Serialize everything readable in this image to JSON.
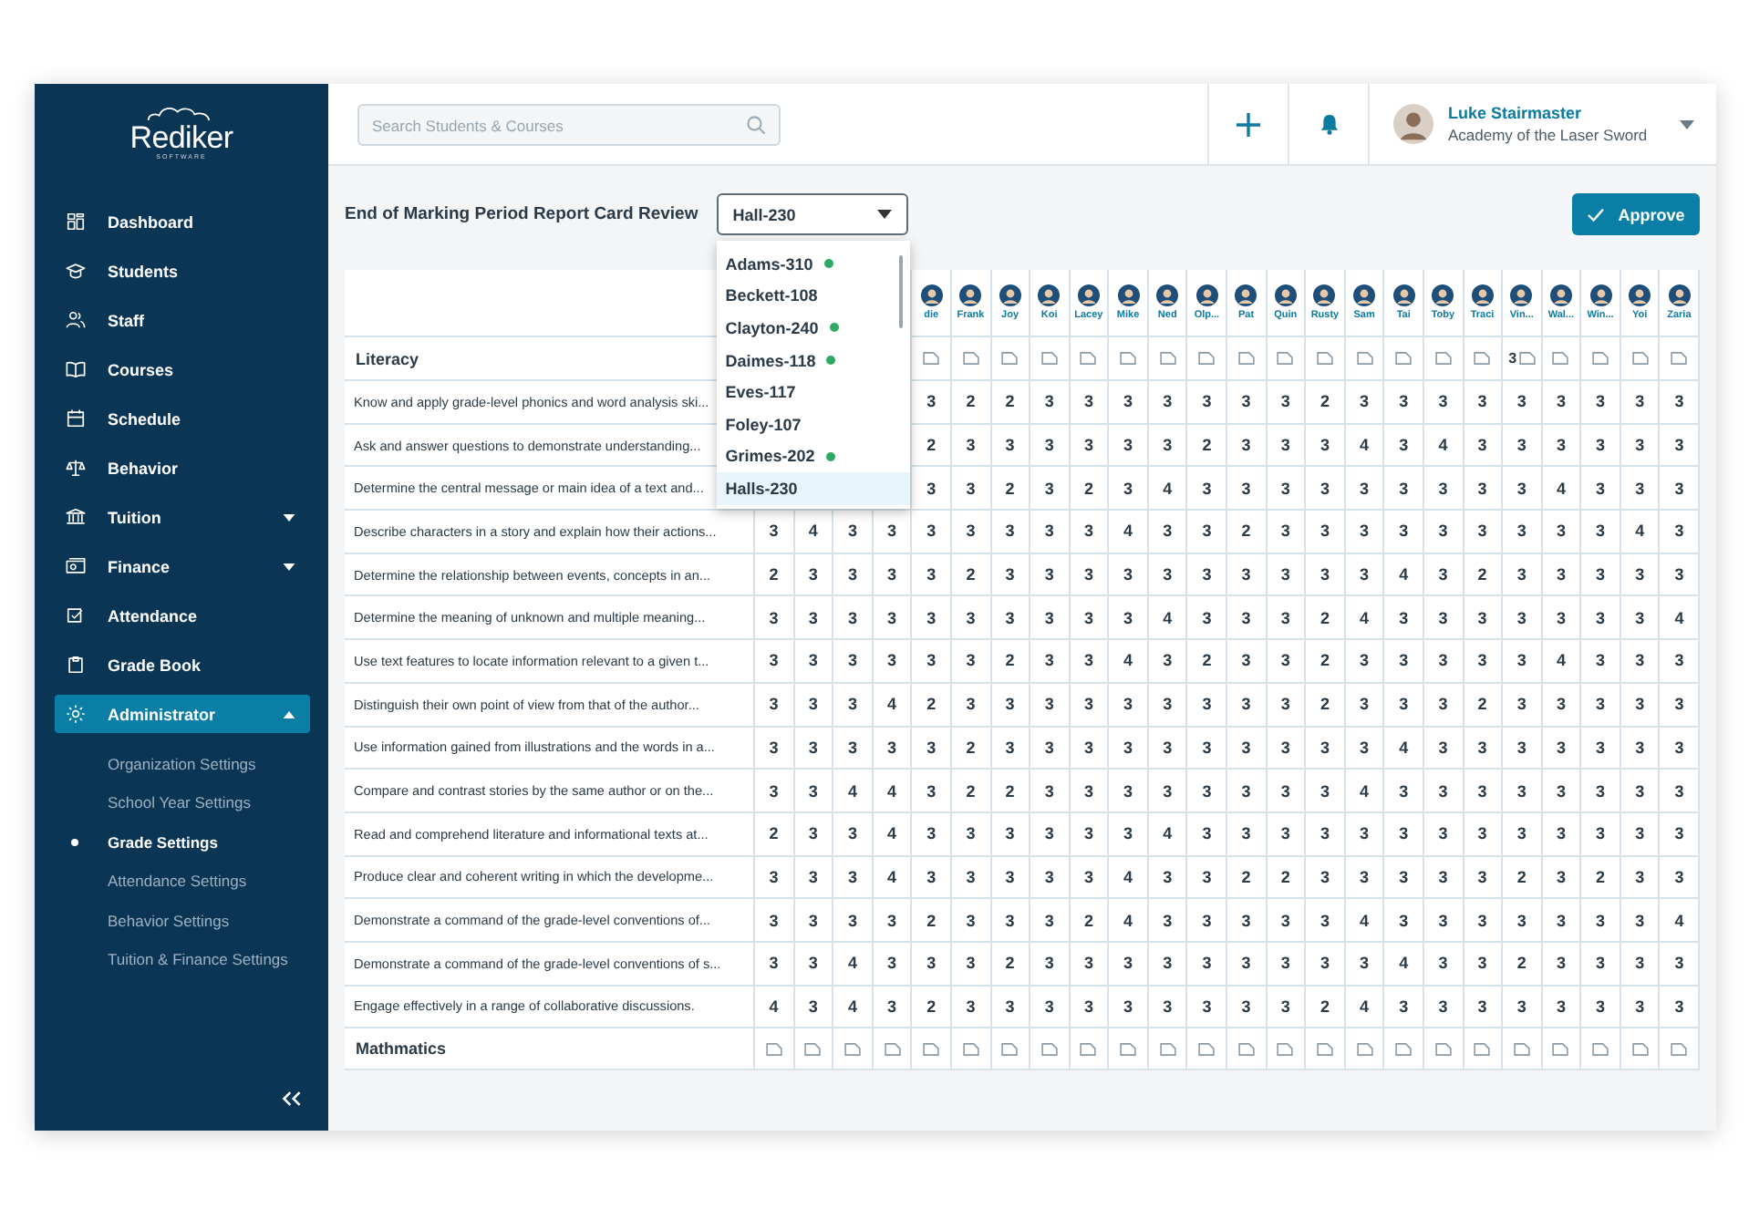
{
  "logo": {
    "name": "Rediker",
    "tagline": "SOFTWARE"
  },
  "sidebar": {
    "items": [
      {
        "label": "Dashboard",
        "selected": false
      },
      {
        "label": "Students",
        "selected": false
      },
      {
        "label": "Staff",
        "selected": false
      },
      {
        "label": "Courses",
        "selected": false
      },
      {
        "label": "Schedule",
        "selected": false
      },
      {
        "label": "Behavior",
        "selected": false
      },
      {
        "label": "Tuition",
        "selected": false,
        "expanded": false
      },
      {
        "label": "Finance",
        "selected": false,
        "expanded": false
      },
      {
        "label": "Attendance",
        "selected": false
      },
      {
        "label": "Grade Book",
        "selected": false
      },
      {
        "label": "Administrator",
        "selected": true,
        "expanded": true,
        "children": [
          {
            "label": "Organization Settings",
            "selected": false
          },
          {
            "label": "School Year Settings",
            "selected": false
          },
          {
            "label": "Grade Settings",
            "selected": true
          },
          {
            "label": "Attendance Settings",
            "selected": false
          },
          {
            "label": "Behavior Settings",
            "selected": false
          },
          {
            "label": "Tuition & Finance Settings",
            "selected": false
          }
        ]
      }
    ]
  },
  "search": {
    "placeholder": "Search Students & Courses"
  },
  "user": {
    "name": "Luke Stairmaster",
    "school": "Academy of the Laser Sword"
  },
  "page_title": "End of Marking Period Report Card Review",
  "homeroom_select": {
    "value": "Hall-230",
    "expanded": true,
    "options": [
      {
        "label": "Adams-310",
        "approved": true,
        "selected": false
      },
      {
        "label": "Beckett-108",
        "approved": false,
        "selected": false
      },
      {
        "label": "Clayton-240",
        "approved": true,
        "selected": false
      },
      {
        "label": "Daimes-118",
        "approved": true,
        "selected": false
      },
      {
        "label": "Eves-117",
        "approved": false,
        "selected": false
      },
      {
        "label": "Foley-107",
        "approved": false,
        "selected": false
      },
      {
        "label": "Grimes-202",
        "approved": true,
        "selected": false
      },
      {
        "label": "Halls-230",
        "approved": false,
        "selected": true
      }
    ]
  },
  "approve_button": {
    "label": "Approve"
  },
  "students": [
    {
      "name": "die"
    },
    {
      "name": "Frank"
    },
    {
      "name": "Joy"
    },
    {
      "name": "Koi"
    },
    {
      "name": "Lacey"
    },
    {
      "name": "Mike"
    },
    {
      "name": "Ned"
    },
    {
      "name": "Olp..."
    },
    {
      "name": "Pat"
    },
    {
      "name": "Quin"
    },
    {
      "name": "Rusty"
    },
    {
      "name": "Sam"
    },
    {
      "name": "Tai"
    },
    {
      "name": "Toby"
    },
    {
      "name": "Traci"
    },
    {
      "name": "Vin...",
      "note_count": "3"
    },
    {
      "name": "Wal..."
    },
    {
      "name": "Win..."
    },
    {
      "name": "Yoi"
    },
    {
      "name": "Zaria"
    }
  ],
  "sections": [
    {
      "title": "Literacy",
      "rows": [
        {
          "label": "Know and apply grade-level phonics and word analysis ski...",
          "values": [
            "3",
            "2",
            "2",
            "3",
            "3",
            "3",
            "3",
            "3",
            "3",
            "3",
            "2",
            "3",
            "3",
            "3",
            "3",
            "3",
            "3",
            "3",
            "3",
            "3"
          ]
        },
        {
          "label": "Ask and answer questions to demonstrate understanding...",
          "values": [
            "2",
            "3",
            "3",
            "3",
            "3",
            "3",
            "3",
            "2",
            "3",
            "3",
            "3",
            "4",
            "3",
            "4",
            "3",
            "3",
            "3",
            "3",
            "3",
            "3"
          ]
        },
        {
          "label": "Determine the central message or main idea of a text and...",
          "values": [
            "3",
            "3",
            "2",
            "3",
            "2",
            "3",
            "4",
            "3",
            "3",
            "3",
            "3",
            "3",
            "3",
            "3",
            "3",
            "3",
            "4",
            "3",
            "3",
            "3"
          ]
        },
        {
          "label": "Describe characters in a story and explain how their actions...",
          "values": [
            "3",
            "4",
            "3",
            "3",
            "3",
            "3",
            "3",
            "3",
            "3",
            "4",
            "3",
            "3",
            "2",
            "3",
            "3",
            "3",
            "3",
            "3",
            "3",
            "3",
            "3",
            "3",
            "4",
            "3"
          ]
        },
        {
          "label": "Determine the relationship between events, concepts in an...",
          "values": [
            "2",
            "3",
            "3",
            "3",
            "3",
            "2",
            "3",
            "3",
            "3",
            "3",
            "3",
            "3",
            "3",
            "3",
            "3",
            "3",
            "4",
            "3",
            "2",
            "3",
            "3",
            "3",
            "3",
            "3"
          ]
        },
        {
          "label": "Determine the meaning of unknown and multiple meaning...",
          "values": [
            "3",
            "3",
            "3",
            "3",
            "3",
            "3",
            "3",
            "3",
            "3",
            "3",
            "4",
            "3",
            "3",
            "3",
            "2",
            "4",
            "3",
            "3",
            "3",
            "3",
            "3",
            "3",
            "3",
            "4"
          ]
        },
        {
          "label": "Use text features to locate information relevant to a given t...",
          "values": [
            "3",
            "3",
            "3",
            "3",
            "3",
            "3",
            "2",
            "3",
            "3",
            "4",
            "3",
            "2",
            "3",
            "3",
            "2",
            "3",
            "3",
            "3",
            "3",
            "3",
            "4",
            "3",
            "3",
            "3"
          ]
        },
        {
          "label": "Distinguish their own point of view from that of the author...",
          "values": [
            "3",
            "3",
            "3",
            "4",
            "2",
            "3",
            "3",
            "3",
            "3",
            "3",
            "3",
            "3",
            "3",
            "3",
            "2",
            "3",
            "3",
            "3",
            "2",
            "3",
            "3",
            "3",
            "3",
            "3"
          ]
        },
        {
          "label": "Use information gained from illustrations and the words in a...",
          "values": [
            "3",
            "3",
            "3",
            "3",
            "3",
            "2",
            "3",
            "3",
            "3",
            "3",
            "3",
            "3",
            "3",
            "3",
            "3",
            "3",
            "4",
            "3",
            "3",
            "3",
            "3",
            "3",
            "3",
            "3"
          ]
        },
        {
          "label": "Compare and contrast stories by the same author or on the...",
          "values": [
            "3",
            "3",
            "4",
            "4",
            "3",
            "2",
            "2",
            "3",
            "3",
            "3",
            "3",
            "3",
            "3",
            "3",
            "3",
            "4",
            "3",
            "3",
            "3",
            "3",
            "3",
            "3",
            "3",
            "3"
          ]
        },
        {
          "label": "Read and comprehend literature and informational texts at...",
          "values": [
            "2",
            "3",
            "3",
            "4",
            "3",
            "3",
            "3",
            "3",
            "3",
            "3",
            "4",
            "3",
            "3",
            "3",
            "3",
            "3",
            "3",
            "3",
            "3",
            "3",
            "3",
            "3",
            "3",
            "3"
          ]
        },
        {
          "label": "Produce clear and coherent writing in which the developme...",
          "values": [
            "3",
            "3",
            "3",
            "4",
            "3",
            "3",
            "3",
            "3",
            "3",
            "4",
            "3",
            "3",
            "2",
            "2",
            "3",
            "3",
            "3",
            "3",
            "3",
            "2",
            "3",
            "2",
            "3",
            "3"
          ]
        },
        {
          "label": "Demonstrate a command of the grade-level conventions of...",
          "values": [
            "3",
            "3",
            "3",
            "3",
            "2",
            "3",
            "3",
            "3",
            "2",
            "4",
            "3",
            "3",
            "3",
            "3",
            "3",
            "4",
            "3",
            "3",
            "3",
            "3",
            "3",
            "3",
            "3",
            "4"
          ]
        },
        {
          "label": "Demonstrate a command of the grade-level conventions of s...",
          "values": [
            "3",
            "3",
            "4",
            "3",
            "3",
            "3",
            "2",
            "3",
            "3",
            "3",
            "3",
            "3",
            "3",
            "3",
            "3",
            "3",
            "4",
            "3",
            "3",
            "2",
            "3",
            "3",
            "3",
            "3"
          ]
        },
        {
          "label": "Engage effectively in a range of collaborative discussions.",
          "values": [
            "4",
            "3",
            "4",
            "3",
            "2",
            "3",
            "3",
            "3",
            "3",
            "3",
            "3",
            "3",
            "3",
            "3",
            "2",
            "4",
            "3",
            "3",
            "3",
            "3",
            "3",
            "3",
            "3",
            "3"
          ]
        }
      ]
    },
    {
      "title": "Mathmatics"
    }
  ]
}
